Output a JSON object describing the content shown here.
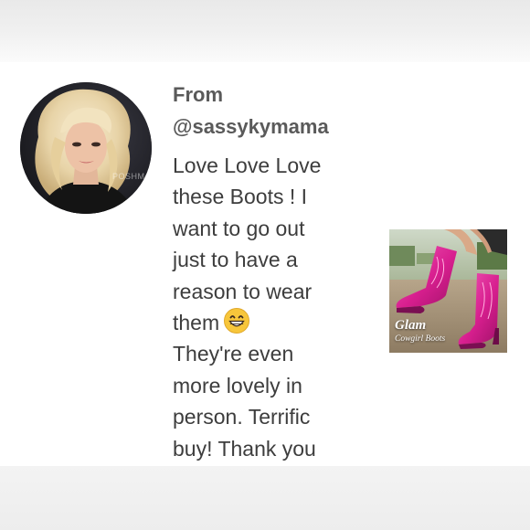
{
  "post": {
    "from_label": "From",
    "username": "@sassykymama",
    "avatar_watermark": "POSHMARK",
    "comment_lines": [
      "Love Love Love",
      "these Boots ! I",
      "want to go out",
      "just to have a",
      "reason to wear",
      "them",
      "They're even",
      "more lovely in",
      "person. Terrific",
      "buy! Thank you"
    ],
    "emoji_icon": "grinning-face-icon"
  },
  "product": {
    "title": "Glam",
    "subtitle": "Cowgirl Boots",
    "boot_color": "#e0299b"
  }
}
